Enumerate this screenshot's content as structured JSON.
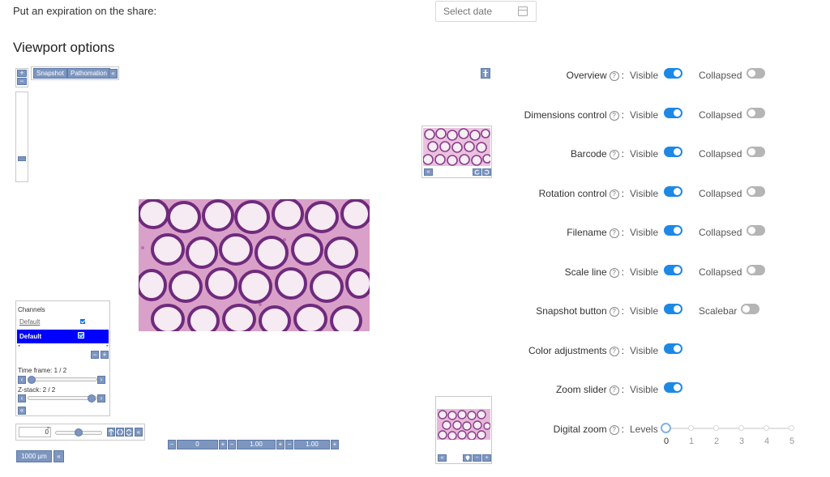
{
  "share": {
    "expiration_label": "Put an expiration on the share:",
    "date_placeholder": "Select date"
  },
  "section_title": "Viewport options",
  "viewer": {
    "snapshot_label": "Snapshot",
    "pathomation_label": "Pathomation",
    "zoom_plus": "+",
    "zoom_minus": "−",
    "collapse_glyph": "«",
    "channels": {
      "title": "Channels",
      "row1_name": "Default",
      "row2_name": "Default",
      "time_frame": "Time frame: 1 / 2",
      "z_stack": "Z-stack: 2 / 2",
      "left_arrow": "‹",
      "right_arrow": "›"
    },
    "rotation": {
      "value": "0",
      "unit": "°"
    },
    "scale_bar": "1000 µm",
    "bottom_bar": {
      "val1": "0",
      "val2": "1.00",
      "val3": "1.00"
    }
  },
  "options": [
    {
      "label": "Overview",
      "visible_label": "Visible",
      "visible": true,
      "extra_label": "Collapsed",
      "extra_on": false
    },
    {
      "label": "Dimensions control",
      "visible_label": "Visible",
      "visible": true,
      "extra_label": "Collapsed",
      "extra_on": false
    },
    {
      "label": "Barcode",
      "visible_label": "Visible",
      "visible": true,
      "extra_label": "Collapsed",
      "extra_on": false
    },
    {
      "label": "Rotation control",
      "visible_label": "Visible",
      "visible": true,
      "extra_label": "Collapsed",
      "extra_on": false
    },
    {
      "label": "Filename",
      "visible_label": "Visible",
      "visible": true,
      "extra_label": "Collapsed",
      "extra_on": false
    },
    {
      "label": "Scale line",
      "visible_label": "Visible",
      "visible": true,
      "extra_label": "Collapsed",
      "extra_on": false
    },
    {
      "label": "Snapshot button",
      "visible_label": "Visible",
      "visible": true,
      "extra_label": "Scalebar",
      "extra_on": false
    },
    {
      "label": "Color adjustments",
      "visible_label": "Visible",
      "visible": true
    },
    {
      "label": "Zoom slider",
      "visible_label": "Visible",
      "visible": true
    }
  ],
  "digital_zoom": {
    "label": "Digital zoom",
    "levels_label": "Levels",
    "levels": [
      "0",
      "1",
      "2",
      "3",
      "4",
      "5"
    ],
    "selected": 0
  },
  "colors": {
    "accent": "#1e88e5",
    "viewer_button": "#7d96bf",
    "channel_selected": "#0000ff"
  }
}
